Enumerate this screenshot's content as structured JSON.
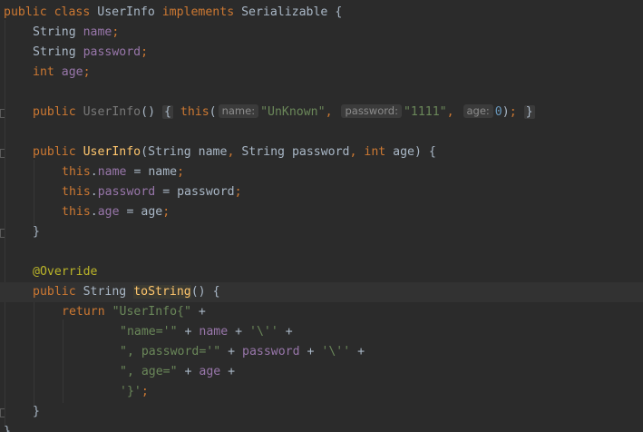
{
  "code": {
    "class_decl": {
      "kw_public": "public",
      "kw_class": "class",
      "class_name": "UserInfo",
      "kw_implements": "implements",
      "interface_name": "Serializable",
      "brace": "{"
    },
    "field_name": {
      "type": "String",
      "name": "name",
      "semi": ";"
    },
    "field_password": {
      "type": "String",
      "name": "password",
      "semi": ";"
    },
    "field_age": {
      "type": "int",
      "name": "age",
      "semi": ";"
    },
    "default_ctor": {
      "kw_public": "public",
      "name": "UserInfo",
      "parens": "()",
      "open_brace": "{",
      "kw_this": "this",
      "open_paren": "(",
      "hint_name": "name:",
      "arg_name": "\"UnKnown\"",
      "comma1": ",",
      "hint_password": "password:",
      "arg_password": "\"1111\"",
      "comma2": ",",
      "hint_age": "age:",
      "arg_age": "0",
      "close_paren": ")",
      "semi": ";",
      "close_brace": "}"
    },
    "full_ctor": {
      "kw_public": "public",
      "name": "UserInfo",
      "open_paren": "(",
      "p1_type": "String",
      "p1_name": "name",
      "comma1": ",",
      "p2_type": "String",
      "p2_name": "password",
      "comma2": ",",
      "p3_type": "int",
      "p3_name": "age",
      "close_paren": ")",
      "brace": "{"
    },
    "assign_name": {
      "kw_this": "this",
      "dot": ".",
      "field": "name",
      "op": "=",
      "value": "name",
      "semi": ";"
    },
    "assign_password": {
      "kw_this": "this",
      "dot": ".",
      "field": "password",
      "op": "=",
      "value": "password",
      "semi": ";"
    },
    "assign_age": {
      "kw_this": "this",
      "dot": ".",
      "field": "age",
      "op": "=",
      "value": "age",
      "semi": ";"
    },
    "close_ctor": "}",
    "annotation": "@Override",
    "tostring_decl": {
      "kw_public": "public",
      "type": "String",
      "name": "toString",
      "parens": "()",
      "brace": "{"
    },
    "ret1": {
      "kw_return": "return",
      "str": "\"UserInfo{\"",
      "plus": "+"
    },
    "ret2": {
      "str": "\"name='\"",
      "plus1": "+",
      "field": "name",
      "plus2": "+",
      "chr": "'\\''",
      "plus3": "+"
    },
    "ret3": {
      "str": "\", password='\"",
      "plus1": "+",
      "field": "password",
      "plus2": "+",
      "chr": "'\\''",
      "plus3": "+"
    },
    "ret4": {
      "str": "\", age=\"",
      "plus1": "+",
      "field": "age",
      "plus2": "+"
    },
    "ret5": {
      "chr": "'}'",
      "semi": ";"
    },
    "close_method": "}",
    "close_class": "}"
  }
}
